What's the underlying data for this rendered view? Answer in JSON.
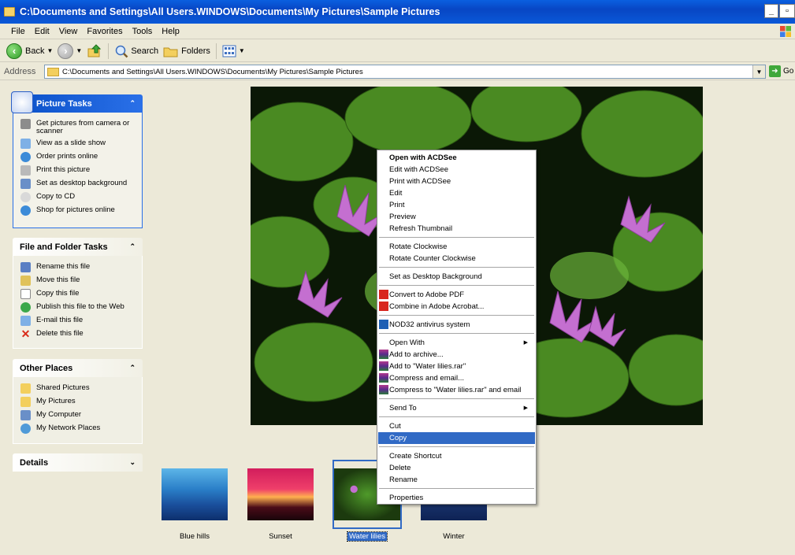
{
  "window": {
    "title": "C:\\Documents and Settings\\All Users.WINDOWS\\Documents\\My Pictures\\Sample Pictures"
  },
  "menubar": [
    "File",
    "Edit",
    "View",
    "Favorites",
    "Tools",
    "Help"
  ],
  "toolbar": {
    "back": "Back",
    "search": "Search",
    "folders": "Folders"
  },
  "address": {
    "label": "Address",
    "value": "C:\\Documents and Settings\\All Users.WINDOWS\\Documents\\My Pictures\\Sample Pictures",
    "go": "Go"
  },
  "picture_tasks": {
    "title": "Picture Tasks",
    "items": [
      "Get pictures from camera or scanner",
      "View as a slide show",
      "Order prints online",
      "Print this picture",
      "Set as desktop background",
      "Copy to CD",
      "Shop for pictures online"
    ]
  },
  "file_tasks": {
    "title": "File and Folder Tasks",
    "items": [
      "Rename this file",
      "Move this file",
      "Copy this file",
      "Publish this file to the Web",
      "E-mail this file",
      "Delete this file"
    ]
  },
  "other_places": {
    "title": "Other Places",
    "items": [
      "Shared Pictures",
      "My Pictures",
      "My Computer",
      "My Network Places"
    ]
  },
  "details": {
    "title": "Details"
  },
  "thumbnails": [
    "Blue hills",
    "Sunset",
    "Water lilies",
    "Winter"
  ],
  "selected_thumbnail": "Water lilies",
  "context_menu": {
    "items": [
      "Open with ACDSee",
      "Edit with ACDSee",
      "Print with ACDSee",
      "Edit",
      "Print",
      "Preview",
      "Refresh Thumbnail",
      "Rotate Clockwise",
      "Rotate Counter Clockwise",
      "Set as Desktop Background",
      "Convert to Adobe PDF",
      "Combine in Adobe Acrobat...",
      "NOD32 antivirus system",
      "Open With",
      "Add to archive...",
      "Add to \"Water lilies.rar\"",
      "Compress and email...",
      "Compress to \"Water lilies.rar\" and email",
      "Send To",
      "Cut",
      "Copy",
      "Create Shortcut",
      "Delete",
      "Rename",
      "Properties"
    ],
    "highlighted": "Copy"
  },
  "colors": {
    "title_bar": "#0a58d8",
    "selection": "#316ac5",
    "panel_bg": "#ece9d8"
  }
}
